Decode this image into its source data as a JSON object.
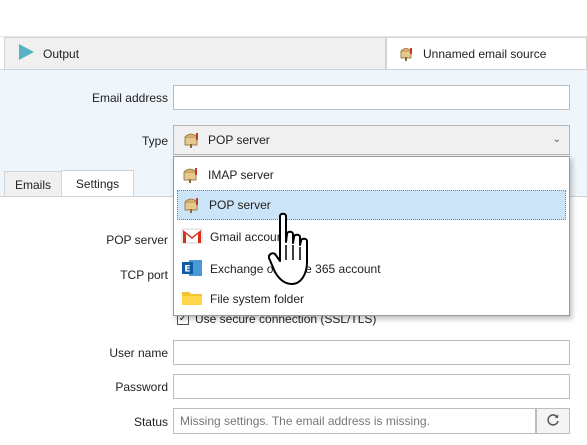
{
  "tabs": {
    "output_label": "Output",
    "active_label": "Unnamed email source"
  },
  "form": {
    "email_label": "Email address",
    "email_value": "",
    "type_label": "Type",
    "type_value": "POP server"
  },
  "inner_tabs": {
    "emails": "Emails",
    "settings": "Settings"
  },
  "settings": {
    "pop_server_label": "POP server",
    "tcp_port_label": "TCP port",
    "ssl_label": "Use secure connection (SSL/TLS)",
    "ssl_checked": true,
    "username_label": "User name",
    "password_label": "Password",
    "status_label": "Status",
    "status_value": "Missing settings. The email address is missing."
  },
  "dropdown": {
    "items": [
      {
        "label": "IMAP server",
        "icon": "mailbox-icon"
      },
      {
        "label": "POP server",
        "icon": "mailbox-icon",
        "selected": true
      },
      {
        "label": "Gmail account",
        "icon": "gmail-icon"
      },
      {
        "label": "Exchange or Office 365 account",
        "icon": "exchange-icon"
      },
      {
        "label": "File system folder",
        "icon": "folder-icon"
      }
    ]
  }
}
